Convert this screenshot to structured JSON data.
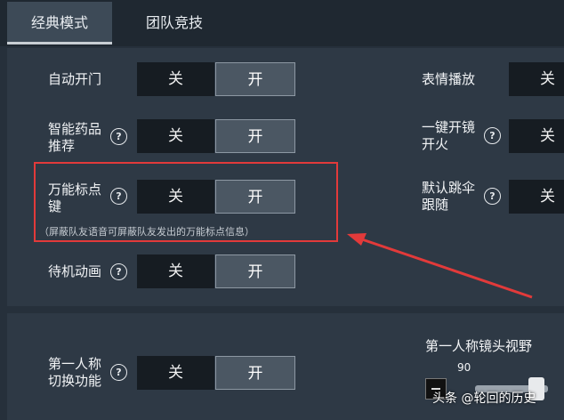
{
  "tabs": [
    {
      "label": "经典模式",
      "active": true
    },
    {
      "label": "团队竞技",
      "active": false
    }
  ],
  "toggle": {
    "off": "关",
    "on": "开"
  },
  "help_glyph": "?",
  "left_settings": {
    "auto_door": "自动开门",
    "smart_med": "智能药品\n推荐",
    "universal_mark": "万能标点\n键",
    "universal_mark_note": "（屏蔽队友语音可屏蔽队友发出的万能标点信息）",
    "idle_anim": "待机动画",
    "first_person_switch": "第一人称\n切换功能"
  },
  "right_settings": {
    "emote_play": "表情播放",
    "scope_fire": "一键开镜\n开火",
    "follow_parachute": "默认跳伞\n跟随",
    "fp_fov": "第一人称镜头视野",
    "fp_fov_value": "90"
  },
  "watermark": "头条 @轮回的历史",
  "colors": {
    "highlight": "#e23a3a",
    "arrow": "#e23a3a"
  }
}
